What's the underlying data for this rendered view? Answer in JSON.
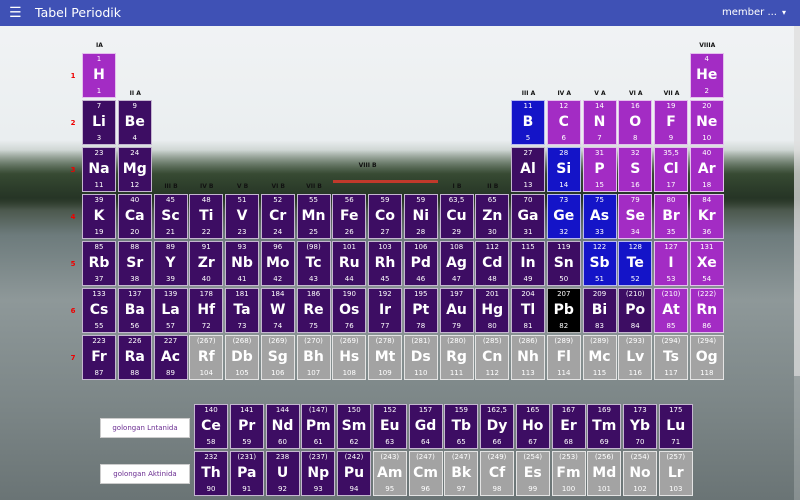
{
  "app": {
    "title": "Tabel Periodik",
    "menu_icon": "☰",
    "user": "member ...",
    "caret": "▾"
  },
  "groups": [
    "IA",
    "II A",
    "III B",
    "IV B",
    "V B",
    "VI B",
    "VII B",
    "VIII B",
    "I B",
    "II B",
    "III A",
    "IV A",
    "V A",
    "VI A",
    "VII A",
    "VIIIA"
  ],
  "periods": [
    "1",
    "2",
    "3",
    "4",
    "5",
    "6",
    "7"
  ],
  "buttons": {
    "lanthanide": "golongan Lntanida",
    "actinide": "golongan Aktinida"
  },
  "colors": {
    "dark": "#3d0d63",
    "magenta": "#a32cc4",
    "blue": "#1414c8",
    "black": "#000000",
    "gray": "#a3a3a3",
    "appbar": "#3f51b5"
  },
  "elements": [
    {
      "s": "H",
      "m": "1",
      "n": "1",
      "c": 1,
      "r": 1,
      "t": "mag"
    },
    {
      "s": "He",
      "m": "4",
      "n": "2",
      "c": 18,
      "r": 1,
      "t": "mag"
    },
    {
      "s": "Li",
      "m": "7",
      "n": "3",
      "c": 1,
      "r": 2,
      "t": "dark"
    },
    {
      "s": "Be",
      "m": "9",
      "n": "4",
      "c": 2,
      "r": 2,
      "t": "dark"
    },
    {
      "s": "B",
      "m": "11",
      "n": "5",
      "c": 13,
      "r": 2,
      "t": "blue"
    },
    {
      "s": "C",
      "m": "12",
      "n": "6",
      "c": 14,
      "r": 2,
      "t": "mag"
    },
    {
      "s": "N",
      "m": "14",
      "n": "7",
      "c": 15,
      "r": 2,
      "t": "mag"
    },
    {
      "s": "O",
      "m": "16",
      "n": "8",
      "c": 16,
      "r": 2,
      "t": "mag"
    },
    {
      "s": "F",
      "m": "19",
      "n": "9",
      "c": 17,
      "r": 2,
      "t": "mag"
    },
    {
      "s": "Ne",
      "m": "20",
      "n": "10",
      "c": 18,
      "r": 2,
      "t": "mag"
    },
    {
      "s": "Na",
      "m": "23",
      "n": "11",
      "c": 1,
      "r": 3,
      "t": "dark"
    },
    {
      "s": "Mg",
      "m": "24",
      "n": "12",
      "c": 2,
      "r": 3,
      "t": "dark"
    },
    {
      "s": "Al",
      "m": "27",
      "n": "13",
      "c": 13,
      "r": 3,
      "t": "dark"
    },
    {
      "s": "Si",
      "m": "28",
      "n": "14",
      "c": 14,
      "r": 3,
      "t": "blue"
    },
    {
      "s": "P",
      "m": "31",
      "n": "15",
      "c": 15,
      "r": 3,
      "t": "mag"
    },
    {
      "s": "S",
      "m": "32",
      "n": "16",
      "c": 16,
      "r": 3,
      "t": "mag"
    },
    {
      "s": "Cl",
      "m": "35,5",
      "n": "17",
      "c": 17,
      "r": 3,
      "t": "mag"
    },
    {
      "s": "Ar",
      "m": "40",
      "n": "18",
      "c": 18,
      "r": 3,
      "t": "mag"
    },
    {
      "s": "K",
      "m": "39",
      "n": "19",
      "c": 1,
      "r": 4,
      "t": "dark"
    },
    {
      "s": "Ca",
      "m": "40",
      "n": "20",
      "c": 2,
      "r": 4,
      "t": "dark"
    },
    {
      "s": "Sc",
      "m": "45",
      "n": "21",
      "c": 3,
      "r": 4,
      "t": "dark"
    },
    {
      "s": "Ti",
      "m": "48",
      "n": "22",
      "c": 4,
      "r": 4,
      "t": "dark"
    },
    {
      "s": "V",
      "m": "51",
      "n": "23",
      "c": 5,
      "r": 4,
      "t": "dark"
    },
    {
      "s": "Cr",
      "m": "52",
      "n": "24",
      "c": 6,
      "r": 4,
      "t": "dark"
    },
    {
      "s": "Mn",
      "m": "55",
      "n": "25",
      "c": 7,
      "r": 4,
      "t": "dark"
    },
    {
      "s": "Fe",
      "m": "56",
      "n": "26",
      "c": 8,
      "r": 4,
      "t": "dark"
    },
    {
      "s": "Co",
      "m": "59",
      "n": "27",
      "c": 9,
      "r": 4,
      "t": "dark"
    },
    {
      "s": "Ni",
      "m": "59",
      "n": "28",
      "c": 10,
      "r": 4,
      "t": "dark"
    },
    {
      "s": "Cu",
      "m": "63,5",
      "n": "29",
      "c": 11,
      "r": 4,
      "t": "dark"
    },
    {
      "s": "Zn",
      "m": "65",
      "n": "30",
      "c": 12,
      "r": 4,
      "t": "dark"
    },
    {
      "s": "Ga",
      "m": "70",
      "n": "31",
      "c": 13,
      "r": 4,
      "t": "dark"
    },
    {
      "s": "Ge",
      "m": "73",
      "n": "32",
      "c": 14,
      "r": 4,
      "t": "blue"
    },
    {
      "s": "As",
      "m": "75",
      "n": "33",
      "c": 15,
      "r": 4,
      "t": "blue"
    },
    {
      "s": "Se",
      "m": "79",
      "n": "34",
      "c": 16,
      "r": 4,
      "t": "mag"
    },
    {
      "s": "Br",
      "m": "80",
      "n": "35",
      "c": 17,
      "r": 4,
      "t": "mag"
    },
    {
      "s": "Kr",
      "m": "84",
      "n": "36",
      "c": 18,
      "r": 4,
      "t": "mag"
    },
    {
      "s": "Rb",
      "m": "85",
      "n": "37",
      "c": 1,
      "r": 5,
      "t": "dark"
    },
    {
      "s": "Sr",
      "m": "88",
      "n": "38",
      "c": 2,
      "r": 5,
      "t": "dark"
    },
    {
      "s": "Y",
      "m": "89",
      "n": "39",
      "c": 3,
      "r": 5,
      "t": "dark"
    },
    {
      "s": "Zr",
      "m": "91",
      "n": "40",
      "c": 4,
      "r": 5,
      "t": "dark"
    },
    {
      "s": "Nb",
      "m": "93",
      "n": "41",
      "c": 5,
      "r": 5,
      "t": "dark"
    },
    {
      "s": "Mo",
      "m": "96",
      "n": "42",
      "c": 6,
      "r": 5,
      "t": "dark"
    },
    {
      "s": "Tc",
      "m": "(98)",
      "n": "43",
      "c": 7,
      "r": 5,
      "t": "dark"
    },
    {
      "s": "Ru",
      "m": "101",
      "n": "44",
      "c": 8,
      "r": 5,
      "t": "dark"
    },
    {
      "s": "Rh",
      "m": "103",
      "n": "45",
      "c": 9,
      "r": 5,
      "t": "dark"
    },
    {
      "s": "Pd",
      "m": "106",
      "n": "46",
      "c": 10,
      "r": 5,
      "t": "dark"
    },
    {
      "s": "Ag",
      "m": "108",
      "n": "47",
      "c": 11,
      "r": 5,
      "t": "dark"
    },
    {
      "s": "Cd",
      "m": "112",
      "n": "48",
      "c": 12,
      "r": 5,
      "t": "dark"
    },
    {
      "s": "In",
      "m": "115",
      "n": "49",
      "c": 13,
      "r": 5,
      "t": "dark"
    },
    {
      "s": "Sn",
      "m": "119",
      "n": "50",
      "c": 14,
      "r": 5,
      "t": "dark"
    },
    {
      "s": "Sb",
      "m": "122",
      "n": "51",
      "c": 15,
      "r": 5,
      "t": "blue"
    },
    {
      "s": "Te",
      "m": "128",
      "n": "52",
      "c": 16,
      "r": 5,
      "t": "blue"
    },
    {
      "s": "I",
      "m": "127",
      "n": "53",
      "c": 17,
      "r": 5,
      "t": "mag"
    },
    {
      "s": "Xe",
      "m": "131",
      "n": "54",
      "c": 18,
      "r": 5,
      "t": "mag"
    },
    {
      "s": "Cs",
      "m": "133",
      "n": "55",
      "c": 1,
      "r": 6,
      "t": "dark"
    },
    {
      "s": "Ba",
      "m": "137",
      "n": "56",
      "c": 2,
      "r": 6,
      "t": "dark"
    },
    {
      "s": "La",
      "m": "139",
      "n": "57",
      "c": 3,
      "r": 6,
      "t": "dark"
    },
    {
      "s": "Hf",
      "m": "178",
      "n": "72",
      "c": 4,
      "r": 6,
      "t": "dark"
    },
    {
      "s": "Ta",
      "m": "181",
      "n": "73",
      "c": 5,
      "r": 6,
      "t": "dark"
    },
    {
      "s": "W",
      "m": "184",
      "n": "74",
      "c": 6,
      "r": 6,
      "t": "dark"
    },
    {
      "s": "Re",
      "m": "186",
      "n": "75",
      "c": 7,
      "r": 6,
      "t": "dark"
    },
    {
      "s": "Os",
      "m": "190",
      "n": "76",
      "c": 8,
      "r": 6,
      "t": "dark"
    },
    {
      "s": "Ir",
      "m": "192",
      "n": "77",
      "c": 9,
      "r": 6,
      "t": "dark"
    },
    {
      "s": "Pt",
      "m": "195",
      "n": "78",
      "c": 10,
      "r": 6,
      "t": "dark"
    },
    {
      "s": "Au",
      "m": "197",
      "n": "79",
      "c": 11,
      "r": 6,
      "t": "dark"
    },
    {
      "s": "Hg",
      "m": "201",
      "n": "80",
      "c": 12,
      "r": 6,
      "t": "dark"
    },
    {
      "s": "Tl",
      "m": "204",
      "n": "81",
      "c": 13,
      "r": 6,
      "t": "dark"
    },
    {
      "s": "Pb",
      "m": "207",
      "n": "82",
      "c": 14,
      "r": 6,
      "t": "black"
    },
    {
      "s": "Bi",
      "m": "209",
      "n": "83",
      "c": 15,
      "r": 6,
      "t": "dark"
    },
    {
      "s": "Po",
      "m": "(210)",
      "n": "84",
      "c": 16,
      "r": 6,
      "t": "dark"
    },
    {
      "s": "At",
      "m": "(210)",
      "n": "85",
      "c": 17,
      "r": 6,
      "t": "mag"
    },
    {
      "s": "Rn",
      "m": "(222)",
      "n": "86",
      "c": 18,
      "r": 6,
      "t": "mag"
    },
    {
      "s": "Fr",
      "m": "223",
      "n": "87",
      "c": 1,
      "r": 7,
      "t": "dark"
    },
    {
      "s": "Ra",
      "m": "226",
      "n": "88",
      "c": 2,
      "r": 7,
      "t": "dark"
    },
    {
      "s": "Ac",
      "m": "227",
      "n": "89",
      "c": 3,
      "r": 7,
      "t": "dark"
    },
    {
      "s": "Rf",
      "m": "(267)",
      "n": "104",
      "c": 4,
      "r": 7,
      "t": "gray"
    },
    {
      "s": "Db",
      "m": "(268)",
      "n": "105",
      "c": 5,
      "r": 7,
      "t": "gray"
    },
    {
      "s": "Sg",
      "m": "(269)",
      "n": "106",
      "c": 6,
      "r": 7,
      "t": "gray"
    },
    {
      "s": "Bh",
      "m": "(270)",
      "n": "107",
      "c": 7,
      "r": 7,
      "t": "gray"
    },
    {
      "s": "Hs",
      "m": "(269)",
      "n": "108",
      "c": 8,
      "r": 7,
      "t": "gray"
    },
    {
      "s": "Mt",
      "m": "(278)",
      "n": "109",
      "c": 9,
      "r": 7,
      "t": "gray"
    },
    {
      "s": "Ds",
      "m": "(281)",
      "n": "110",
      "c": 10,
      "r": 7,
      "t": "gray"
    },
    {
      "s": "Rg",
      "m": "(280)",
      "n": "111",
      "c": 11,
      "r": 7,
      "t": "gray"
    },
    {
      "s": "Cn",
      "m": "(285)",
      "n": "112",
      "c": 12,
      "r": 7,
      "t": "gray"
    },
    {
      "s": "Nh",
      "m": "(286)",
      "n": "113",
      "c": 13,
      "r": 7,
      "t": "gray"
    },
    {
      "s": "Fl",
      "m": "(289)",
      "n": "114",
      "c": 14,
      "r": 7,
      "t": "gray"
    },
    {
      "s": "Mc",
      "m": "(289)",
      "n": "115",
      "c": 15,
      "r": 7,
      "t": "gray"
    },
    {
      "s": "Lv",
      "m": "(293)",
      "n": "116",
      "c": 16,
      "r": 7,
      "t": "gray"
    },
    {
      "s": "Ts",
      "m": "(294)",
      "n": "117",
      "c": 17,
      "r": 7,
      "t": "gray"
    },
    {
      "s": "Og",
      "m": "(294)",
      "n": "118",
      "c": 18,
      "r": 7,
      "t": "gray"
    }
  ],
  "lanthanides": [
    {
      "s": "Ce",
      "m": "140",
      "n": "58",
      "t": "dark"
    },
    {
      "s": "Pr",
      "m": "141",
      "n": "59",
      "t": "dark"
    },
    {
      "s": "Nd",
      "m": "144",
      "n": "60",
      "t": "dark"
    },
    {
      "s": "Pm",
      "m": "(147)",
      "n": "61",
      "t": "dark"
    },
    {
      "s": "Sm",
      "m": "150",
      "n": "62",
      "t": "dark"
    },
    {
      "s": "Eu",
      "m": "152",
      "n": "63",
      "t": "dark"
    },
    {
      "s": "Gd",
      "m": "157",
      "n": "64",
      "t": "dark"
    },
    {
      "s": "Tb",
      "m": "159",
      "n": "65",
      "t": "dark"
    },
    {
      "s": "Dy",
      "m": "162,5",
      "n": "66",
      "t": "dark"
    },
    {
      "s": "Ho",
      "m": "165",
      "n": "67",
      "t": "dark"
    },
    {
      "s": "Er",
      "m": "167",
      "n": "68",
      "t": "dark"
    },
    {
      "s": "Tm",
      "m": "169",
      "n": "69",
      "t": "dark"
    },
    {
      "s": "Yb",
      "m": "173",
      "n": "70",
      "t": "dark"
    },
    {
      "s": "Lu",
      "m": "175",
      "n": "71",
      "t": "dark"
    }
  ],
  "actinides": [
    {
      "s": "Th",
      "m": "232",
      "n": "90",
      "t": "dark"
    },
    {
      "s": "Pa",
      "m": "(231)",
      "n": "91",
      "t": "dark"
    },
    {
      "s": "U",
      "m": "238",
      "n": "92",
      "t": "dark"
    },
    {
      "s": "Np",
      "m": "(237)",
      "n": "93",
      "t": "dark"
    },
    {
      "s": "Pu",
      "m": "(242)",
      "n": "94",
      "t": "dark"
    },
    {
      "s": "Am",
      "m": "(243)",
      "n": "95",
      "t": "gray"
    },
    {
      "s": "Cm",
      "m": "(247)",
      "n": "96",
      "t": "gray"
    },
    {
      "s": "Bk",
      "m": "(247)",
      "n": "97",
      "t": "gray"
    },
    {
      "s": "Cf",
      "m": "(249)",
      "n": "98",
      "t": "gray"
    },
    {
      "s": "Es",
      "m": "(254)",
      "n": "99",
      "t": "gray"
    },
    {
      "s": "Fm",
      "m": "(253)",
      "n": "100",
      "t": "gray"
    },
    {
      "s": "Md",
      "m": "(256)",
      "n": "101",
      "t": "gray"
    },
    {
      "s": "No",
      "m": "(254)",
      "n": "102",
      "t": "gray"
    },
    {
      "s": "Lr",
      "m": "(257)",
      "n": "103",
      "t": "gray"
    }
  ]
}
